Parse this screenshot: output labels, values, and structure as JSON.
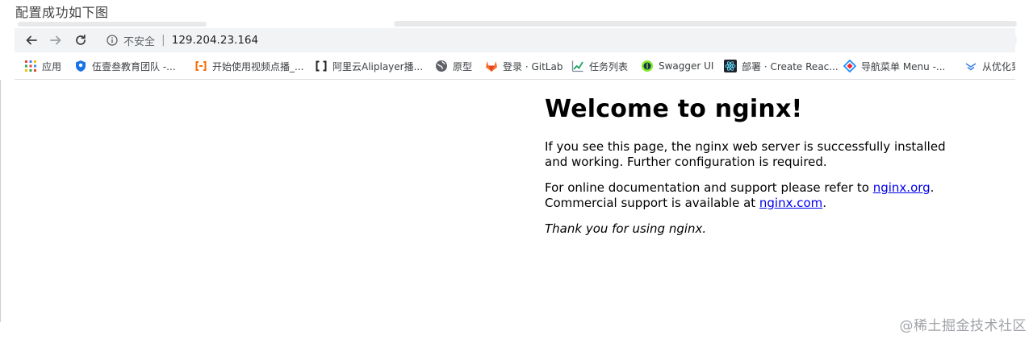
{
  "caption": "配置成功如下图",
  "toolbar": {
    "security_label": "不安全",
    "separator": "|",
    "url": "129.204.23.164"
  },
  "bookmarks": [
    {
      "label": "应用",
      "icon": "apps-grid-icon"
    },
    {
      "label": "伍壹叁教育团队 -...",
      "icon": "team-shield-icon"
    },
    {
      "label": "开始使用视频点播_...",
      "icon": "aliyun-icon"
    },
    {
      "label": "阿里云Aliplayer播...",
      "icon": "aliyun-bracket-icon"
    },
    {
      "label": "原型",
      "icon": "globe-icon"
    },
    {
      "label": "登录 · GitLab",
      "icon": "gitlab-icon"
    },
    {
      "label": "任务列表",
      "icon": "chart-icon"
    },
    {
      "label": "Swagger UI",
      "icon": "swagger-icon"
    },
    {
      "label": "部署 · Create Reac...",
      "icon": "react-icon"
    },
    {
      "label": "导航菜单 Menu -...",
      "icon": "diamond-icon"
    },
    {
      "label": "从优化到",
      "icon": "chevrons-icon"
    }
  ],
  "page": {
    "heading": "Welcome to nginx!",
    "para1": "If you see this page, the nginx web server is successfully installed and working. Further configuration is required.",
    "para2_before": "For online documentation and support please refer to ",
    "link1": "nginx.org",
    "para2_mid": ".",
    "para2_second": "Commercial support is available at ",
    "link2": "nginx.com",
    "para2_end": ".",
    "thanks": "Thank you for using nginx."
  },
  "watermark": "@稀土掘金技术社区"
}
